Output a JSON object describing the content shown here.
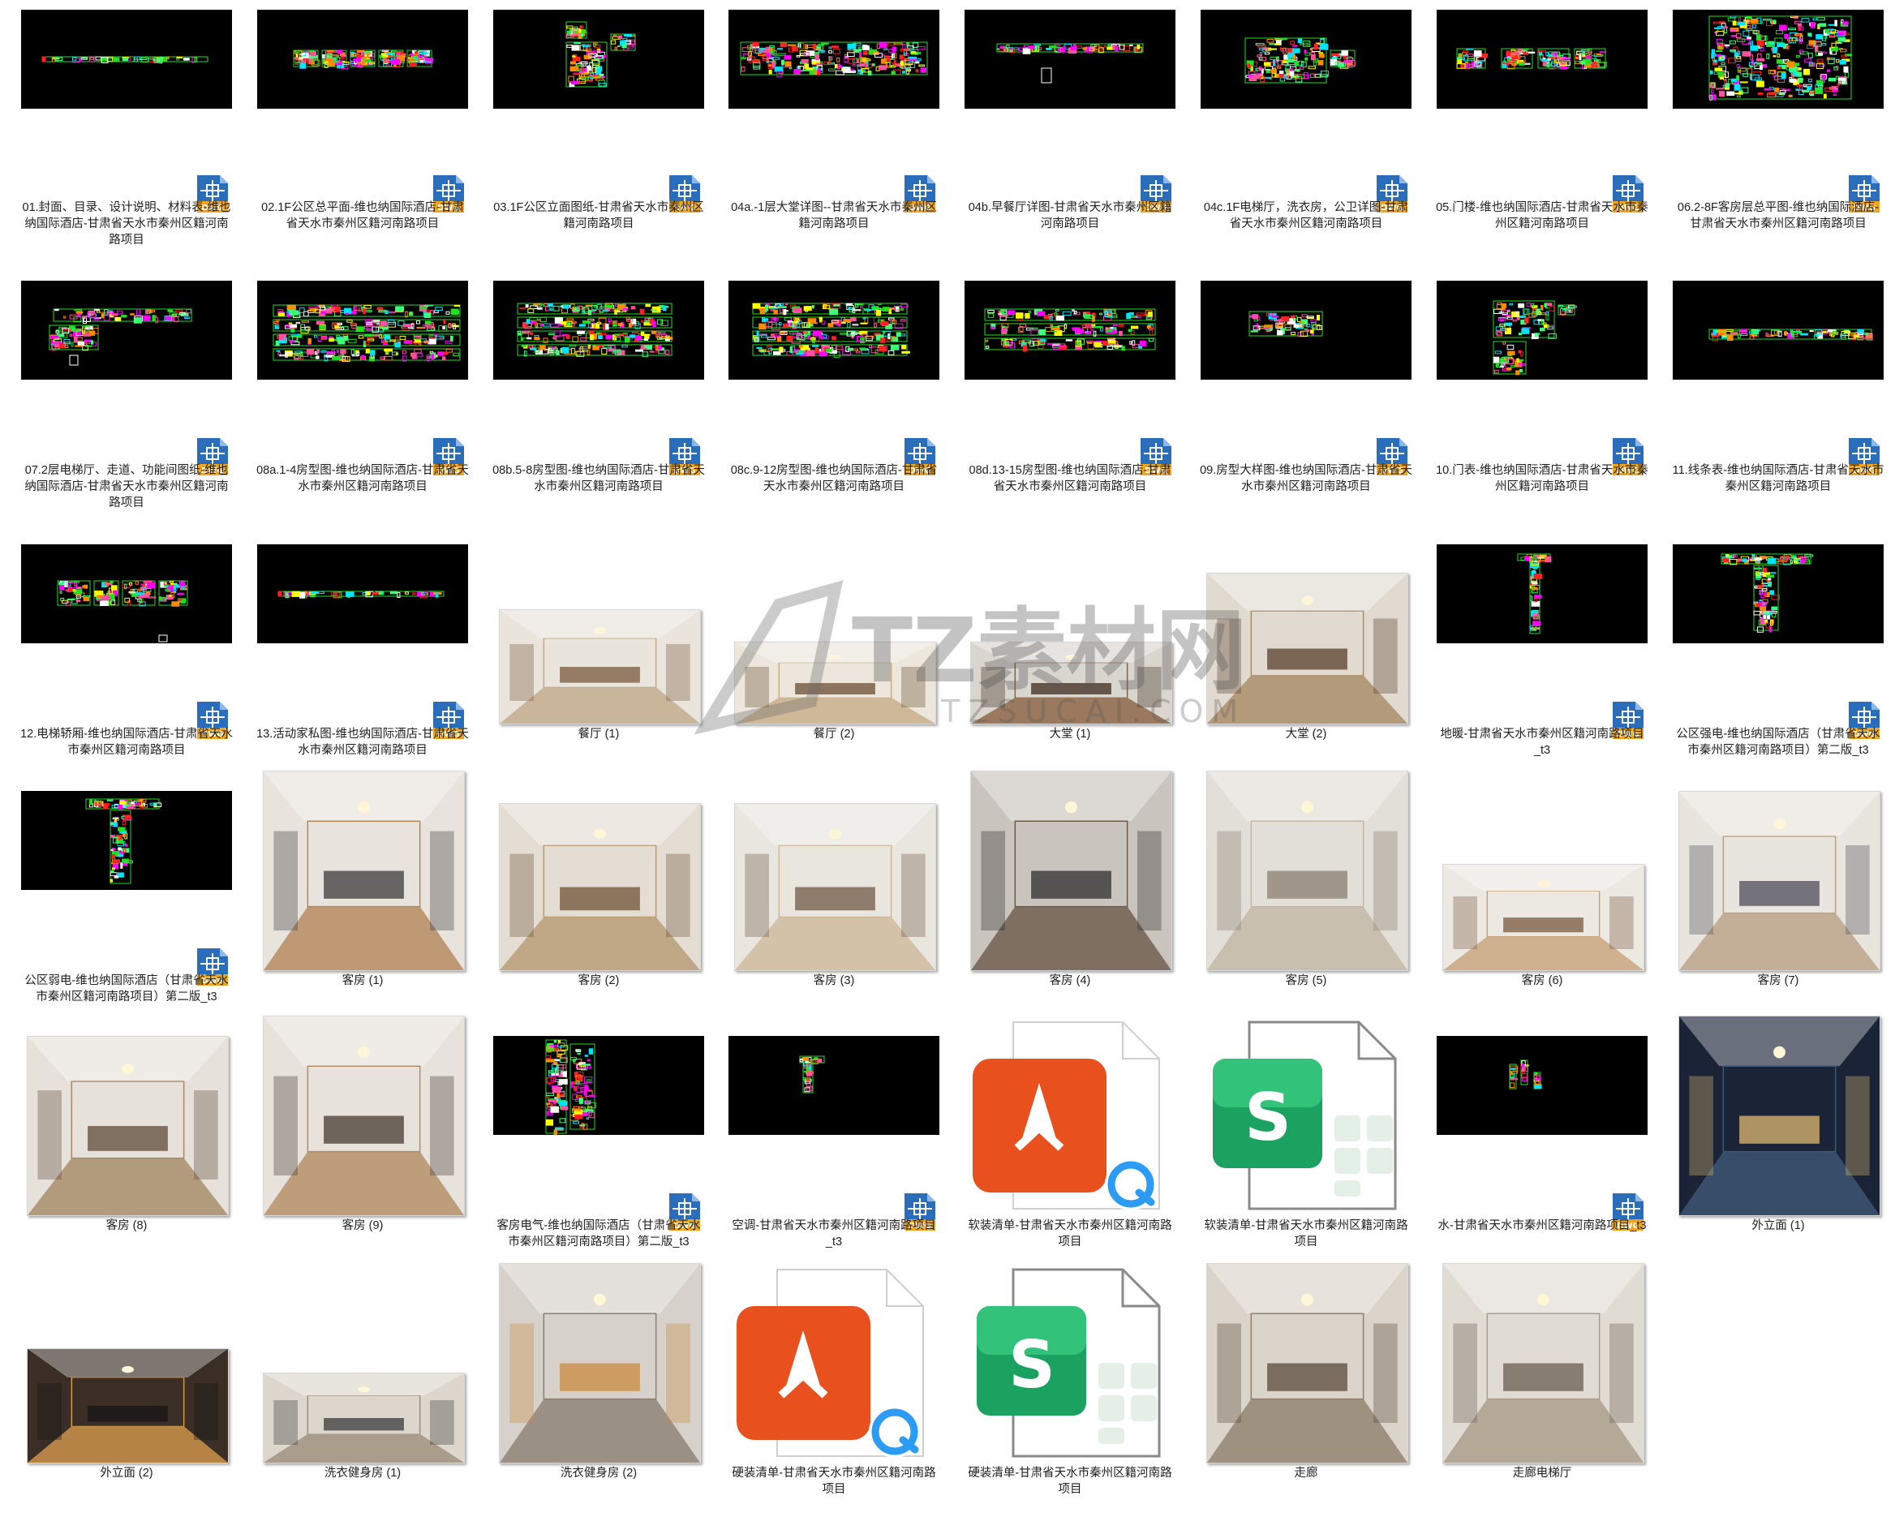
{
  "files": [
    {
      "label": "01.封面、目录、设计说明、材料表-维也纳国际酒店-甘肃省天水市秦州区籍河南路项目",
      "kind": "dwg",
      "plan": "strip-thin",
      "badge": "DWG"
    },
    {
      "label": "02.1F公区总平面-维也纳国际酒店-甘肃省天水市秦州区籍河南路项目",
      "kind": "dwg",
      "plan": "row5",
      "badge": "DWG"
    },
    {
      "label": "03.1F公区立面图纸-甘肃省天水市秦州区籍河南路项目",
      "kind": "dwg",
      "plan": "stack",
      "badge": "DWG"
    },
    {
      "label": "04a.-1层大堂详图--甘肃省天水市秦州区籍河南路项目",
      "kind": "dwg",
      "plan": "band",
      "badge": "DWG"
    },
    {
      "label": "04b.早餐厅详图-甘肃省天水市秦州区籍河南路项目",
      "kind": "dwg",
      "plan": "strip",
      "badge": "DWG"
    },
    {
      "label": "04c.1F电梯厅，洗衣房，公卫详图-甘肃省天水市秦州区籍河南路项目",
      "kind": "dwg",
      "plan": "block",
      "badge": "DWG"
    },
    {
      "label": "05.门楼-维也纳国际酒店-甘肃省天水市秦州区籍河南路项目",
      "kind": "dwg",
      "plan": "row4",
      "badge": "DWG"
    },
    {
      "label": "06.2-8F客房层总平图-维也纳国际酒店-甘肃省天水市秦州区籍河南路项目",
      "kind": "dwg",
      "plan": "dense",
      "badge": "DWG"
    },
    {
      "label": "07.2层电梯厅、走道、功能间图纸-维也纳国际酒店-甘肃省天水市秦州区籍河南路项目",
      "kind": "dwg",
      "plan": "lblock",
      "badge": "DWG"
    },
    {
      "label": "08a.1-4房型图-维也纳国际酒店-甘肃省天水市秦州区籍河南路项目",
      "kind": "dwg",
      "plan": "grid4",
      "badge": "DWG"
    },
    {
      "label": "08b.5-8房型图-维也纳国际酒店-甘肃省天水市秦州区籍河南路项目",
      "kind": "dwg",
      "plan": "grid4s",
      "badge": "DWG"
    },
    {
      "label": "08c.9-12房型图-维也纳国际酒店-甘肃省天水市秦州区籍河南路项目",
      "kind": "dwg",
      "plan": "grid4s",
      "badge": "DWG"
    },
    {
      "label": "08d.13-15房型图-维也纳国际酒店-甘肃省天水市秦州区籍河南路项目",
      "kind": "dwg",
      "plan": "grid3",
      "badge": "DWG"
    },
    {
      "label": "09.房型大样图-维也纳国际酒店-甘肃省天水市秦州区籍河南路项目",
      "kind": "dwg",
      "plan": "small",
      "badge": "DWG"
    },
    {
      "label": "10.门表-维也纳国际酒店-甘肃省天水市秦州区籍河南路项目",
      "kind": "dwg",
      "plan": "tblock",
      "badge": "DWG"
    },
    {
      "label": "11.线条表-维也纳国际酒店-甘肃省天水市秦州区籍河南路项目",
      "kind": "dwg",
      "plan": "strip-red",
      "badge": "DWG"
    },
    {
      "label": "12.电梯轿厢-维也纳国际酒店-甘肃省天水市秦州区籍河南路项目",
      "kind": "dwg",
      "plan": "row4b",
      "badge": "DWG"
    },
    {
      "label": "13.活动家私图-维也纳国际酒店-甘肃省天水市秦州区籍河南路项目",
      "kind": "dwg",
      "plan": "strip-thin",
      "badge": "DWG"
    },
    {
      "label": "餐厅 (1)",
      "kind": "photo",
      "scene": "dining1"
    },
    {
      "label": "餐厅 (2)",
      "kind": "photo",
      "scene": "dining2"
    },
    {
      "label": "大堂 (1)",
      "kind": "photo",
      "scene": "lobby1"
    },
    {
      "label": "大堂 (2)",
      "kind": "photo",
      "scene": "lobby2"
    },
    {
      "label": "地暖-甘肃省天水市秦州区籍河南路项目_t3",
      "kind": "dwg",
      "plan": "vstrip",
      "badge": "DWG"
    },
    {
      "label": "公区强电-维也纳国际酒店（甘肃省天水市秦州区籍河南路项目）第二版_t3",
      "kind": "dwg",
      "plan": "tshape",
      "badge": "DWG"
    },
    {
      "label": "公区弱电-维也纳国际酒店（甘肃省天水市秦州区籍河南路项目）第二版_t3",
      "kind": "dwg",
      "plan": "tshape2",
      "badge": "DWG"
    },
    {
      "label": "客房 (1)",
      "kind": "photo",
      "scene": "room-loft"
    },
    {
      "label": "客房 (2)",
      "kind": "photo",
      "scene": "bath"
    },
    {
      "label": "客房 (3)",
      "kind": "photo",
      "scene": "room-a"
    },
    {
      "label": "客房 (4)",
      "kind": "photo",
      "scene": "hall"
    },
    {
      "label": "客房 (5)",
      "kind": "photo",
      "scene": "bath2"
    },
    {
      "label": "客房 (6)",
      "kind": "photo",
      "scene": "room-b"
    },
    {
      "label": "客房 (7)",
      "kind": "photo",
      "scene": "room-c"
    },
    {
      "label": "客房 (8)",
      "kind": "photo",
      "scene": "room-d"
    },
    {
      "label": "客房 (9)",
      "kind": "photo",
      "scene": "room-loft2"
    },
    {
      "label": "客房电气-维也纳国际酒店（甘肃省天水市秦州区籍河南路项目）第二版_t3",
      "kind": "dwg",
      "plan": "vgreen",
      "badge": "DWG"
    },
    {
      "label": "空调-甘肃省天水市秦州区籍河南路项目_t3",
      "kind": "dwg",
      "plan": "vsmall",
      "badge": "DWG"
    },
    {
      "label": "软装清单-甘肃省天水市秦州区籍河南路项目",
      "kind": "pdf"
    },
    {
      "label": "软装清单-甘肃省天水市秦州区籍河南路项目",
      "kind": "sheet"
    },
    {
      "label": "水-甘肃省天水市秦州区籍河南路项目_t3",
      "kind": "dwg",
      "plan": "vtiny",
      "badge": "DWG"
    },
    {
      "label": "外立面 (1)",
      "kind": "photo",
      "scene": "tower"
    },
    {
      "label": "外立面 (2)",
      "kind": "photo",
      "scene": "storefront"
    },
    {
      "label": "洗衣健身房 (1)",
      "kind": "photo",
      "scene": "gym"
    },
    {
      "label": "洗衣健身房 (2)",
      "kind": "photo",
      "scene": "laundry"
    },
    {
      "label": "硬装清单-甘肃省天水市秦州区籍河南路项目",
      "kind": "pdf"
    },
    {
      "label": "硬装清单-甘肃省天水市秦州区籍河南路项目",
      "kind": "sheet"
    },
    {
      "label": "走廊",
      "kind": "photo",
      "scene": "corridor"
    },
    {
      "label": "走廊电梯厅",
      "kind": "photo",
      "scene": "corridor2"
    }
  ],
  "watermark": {
    "text": "TZ素材网",
    "subtext": "TZSUCAI.COM"
  },
  "colors": {
    "cad_bg": "#000000",
    "dwg_blue": "#2a6ebb",
    "dwg_orange": "#f2a51a",
    "pdf_red": "#e8501e",
    "sheet_green": "#1ba260"
  }
}
